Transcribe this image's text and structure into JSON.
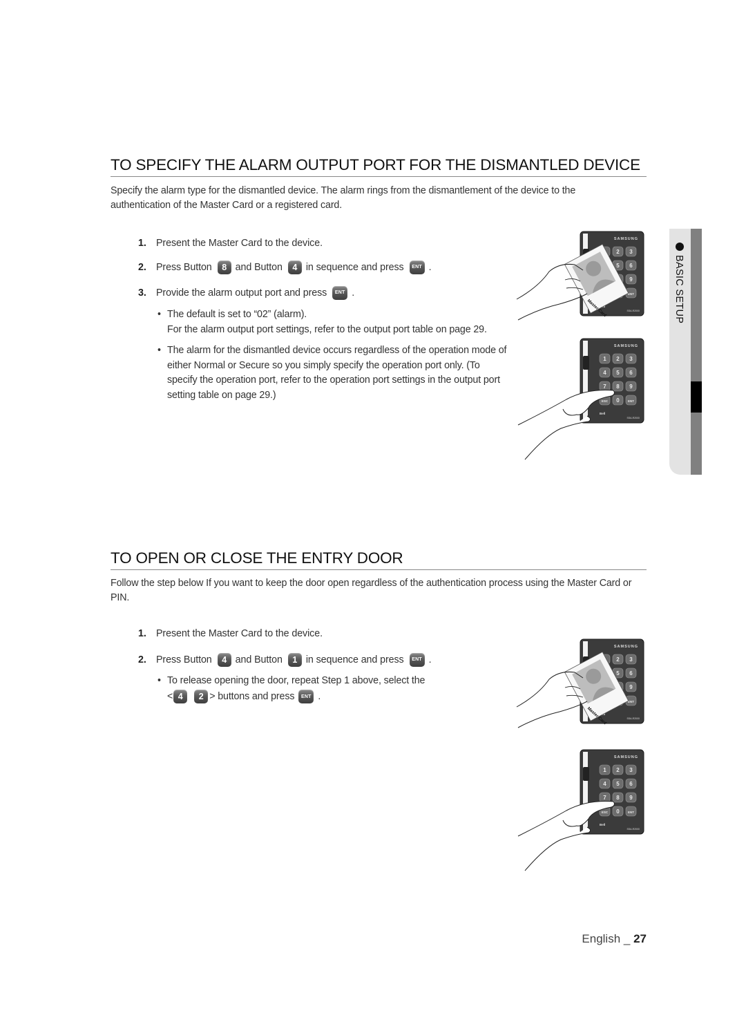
{
  "section1": {
    "title": "TO SPECIFY THE ALARM OUTPUT PORT FOR THE DISMANTLED DEVICE",
    "intro": "Specify the alarm type for the dismantled device. The alarm rings from the dismantlement of the device to the authentication of the Master Card or a registered card.",
    "steps": [
      {
        "num": "1.",
        "text": "Present the Master Card to the device."
      },
      {
        "num": "2.",
        "parts": [
          "Press Button",
          "and Button",
          "in sequence and press",
          "."
        ],
        "keys": [
          "8",
          "4",
          "ENT"
        ]
      },
      {
        "num": "3.",
        "parts": [
          "Provide the alarm output port and press",
          "."
        ],
        "keys": [
          "ENT"
        ]
      }
    ],
    "bullets": [
      "The default is set to “02” (alarm).",
      "For the alarm output port settings, refer to the output port table on page 29.",
      "The alarm for the dismantled device occurs regardless of the operation mode of either Normal or Secure so you simply specify the operation port only. (To specify the operation port, refer to the operation port settings in the output port setting table on page 29.)"
    ]
  },
  "section2": {
    "title": "TO OPEN OR CLOSE THE ENTRY DOOR",
    "intro": "Follow the step below If you want to keep the door open regardless of the authentication process using the Master Card or PIN.",
    "steps": [
      {
        "num": "1.",
        "text": "Present the Master Card to the device."
      },
      {
        "num": "2.",
        "parts": [
          "Press Button",
          "and Button",
          "in sequence and press",
          "."
        ],
        "keys": [
          "4",
          "1",
          "ENT"
        ]
      }
    ],
    "bullet": {
      "line1": "To release opening the door, repeat Step 1 above, select the",
      "open": "<",
      "keys": [
        "4",
        "2",
        "ENT"
      ],
      "close": "> buttons and press",
      "end": "."
    }
  },
  "illustration": {
    "brand": "SAMSUNG",
    "card_label": "Master Card",
    "keypad": [
      "1",
      "2",
      "3",
      "4",
      "5",
      "6",
      "7",
      "8",
      "9",
      "ESC",
      "0",
      "ENT"
    ],
    "bell_label": "Bell",
    "model": "SSA-R2000"
  },
  "side_tab": {
    "label": "BASIC SETUP"
  },
  "footer": {
    "language": "English _ ",
    "page": "27"
  }
}
